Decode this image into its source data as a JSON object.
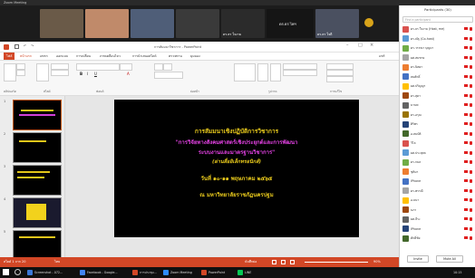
{
  "zoom": {
    "title": "Zoom Meeting",
    "videos": [
      {
        "name": "",
        "color": "#6a5a48"
      },
      {
        "name": "",
        "color": "#c08a6a"
      },
      {
        "name": "",
        "color": "#4f5e78"
      },
      {
        "name": "",
        "color": "#3a3a3a"
      },
      {
        "name": "ดร.ธร ใจงาม",
        "color": "#2b2b2b"
      },
      {
        "name": "ดร.ธร ใจดี",
        "color": "#4a5060"
      },
      {
        "name": "",
        "color": "#5a4a3a"
      }
    ],
    "center_label": "ดร.ธร ไพฯ"
  },
  "ppt": {
    "title": "การสัมมนาวิชาการ - PowerPoint",
    "tabs": [
      "ไฟล์",
      "หน้าแรก",
      "แทรก",
      "ออกแบบ",
      "การเปลี่ยน",
      "ภาพเคลื่อนไหว",
      "การนำเสนอสไลด์",
      "ตรวจทาน",
      "มุมมอง"
    ],
    "share_label": "แชร์",
    "ribbon_groups": [
      "คลิปบอร์ด",
      "สไลด์",
      "ฟอนต์",
      "ย่อหน้า",
      "รูปวาด",
      "การแก้ไข"
    ],
    "thumb_count": 5,
    "notes_placeholder": "คลิกเพื่อเพิ่มบันทึกย่อ",
    "slide": {
      "line1": "การสัมมนาเชิงปฏิบัติการวิชาการ",
      "line2": "\"การวิจัยทางสังคมศาสตร์เชิงประยุกต์และการพัฒนา",
      "line3": "ระบบงานและมาตรฐานวิชาการ\"",
      "line4": "(ผ่านสื่ออิเล็กทรอนิกส์)",
      "line5": "วันที่ ๑๐-๑๑ พฤษภาคม ๒๕๖๕",
      "line6": "ณ มหาวิทยาลัยราชภัฏนครปฐม"
    }
  },
  "participants": {
    "header": "Participants (30)",
    "search_placeholder": "Find a participant",
    "items": [
      {
        "name": "ดร.ธร ใจงาม (Host, me)",
        "color": "#d9534f"
      },
      {
        "name": "ดร.ณัฐ (Co-host)",
        "color": "#5b9bd5"
      },
      {
        "name": "ดร.วรรณา บุญมา",
        "color": "#70ad47"
      },
      {
        "name": "ผศ.สมชาย",
        "color": "#a5a5a5"
      },
      {
        "name": "ดร.นิตยา",
        "color": "#ed7d31"
      },
      {
        "name": "สมศักดิ์",
        "color": "#4472c4"
      },
      {
        "name": "ผศ.ปริญญา",
        "color": "#ffc000"
      },
      {
        "name": "ดร.สุดา",
        "color": "#9e480e"
      },
      {
        "name": "มานพ",
        "color": "#636363"
      },
      {
        "name": "ดร.อรุณ",
        "color": "#997300"
      },
      {
        "name": "ศิริพร",
        "color": "#264478"
      },
      {
        "name": "อ.สมบัติ",
        "color": "#43682b"
      },
      {
        "name": "วิไล",
        "color": "#d9534f"
      },
      {
        "name": "ผศ.ประยุทธ",
        "color": "#5b9bd5"
      },
      {
        "name": "ดร.กมล",
        "color": "#70ad47"
      },
      {
        "name": "ชุติมา",
        "color": "#ed7d31"
      },
      {
        "name": "iPhone",
        "color": "#4472c4"
      },
      {
        "name": "ดร.พรรณี",
        "color": "#a5a5a5"
      },
      {
        "name": "อ.ธนา",
        "color": "#ffc000"
      },
      {
        "name": "นภา",
        "color": "#9e480e"
      },
      {
        "name": "ผศ.ธีระ",
        "color": "#636363"
      },
      {
        "name": "iPhone",
        "color": "#264478"
      },
      {
        "name": "ศักดิ์ชัย",
        "color": "#43682b"
      }
    ],
    "invite": "Invite",
    "mute_all": "Mute All"
  },
  "statusbar": {
    "slide_info": "สไลด์ 1 จาก 20",
    "language": "ไทย",
    "notes": "บันทึกย่อ",
    "zoom_level": "90%"
  },
  "taskbar": {
    "items": [
      "Screenshot - 072...",
      "Facebook - Google...",
      "การประชุม...",
      "Zoom Meeting",
      "PowerPoint",
      "LINE"
    ],
    "time": "10:15"
  }
}
